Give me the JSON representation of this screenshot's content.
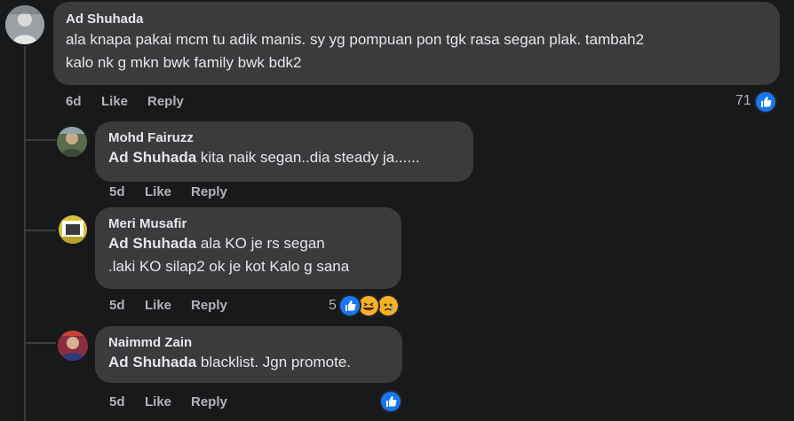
{
  "colors": {
    "background": "#18191a",
    "bubble": "#3a3b3c",
    "text": "#e4e6eb",
    "muted": "#b0b3b8",
    "like_blue": "#1877f2",
    "thread_line": "#3a3b3c"
  },
  "comments": [
    {
      "author": "Ad Shuhada",
      "text": "ala knapa pakai mcm tu adik manis. sy yg pompuan pon tgk rasa segan plak. tambah2",
      "text2": "kalo nk g mkn bwk family bwk bdk2",
      "time": "6d",
      "like_label": "Like",
      "reply_label": "Reply",
      "reaction_count": "71",
      "reactions": [
        "like-icon"
      ]
    },
    {
      "author": "Mohd Fairuzz",
      "tag": "Ad Shuhada",
      "text": " kita naik segan..dia steady ja......",
      "time": "5d",
      "like_label": "Like",
      "reply_label": "Reply"
    },
    {
      "author": "Meri Musafir",
      "tag": "Ad Shuhada",
      "text": " ala KO je rs segan",
      "text2": ".laki KO silap2 ok je kot Kalo g sana",
      "time": "5d",
      "like_label": "Like",
      "reply_label": "Reply",
      "reaction_count": "5",
      "reactions": [
        "like-icon",
        "haha-icon",
        "sad-icon"
      ]
    },
    {
      "author": "Naimmd Zain",
      "tag": "Ad Shuhada",
      "text": " blacklist. Jgn promote.",
      "time": "5d",
      "like_label": "Like",
      "reply_label": "Reply",
      "reactions": [
        "like-icon"
      ]
    }
  ]
}
